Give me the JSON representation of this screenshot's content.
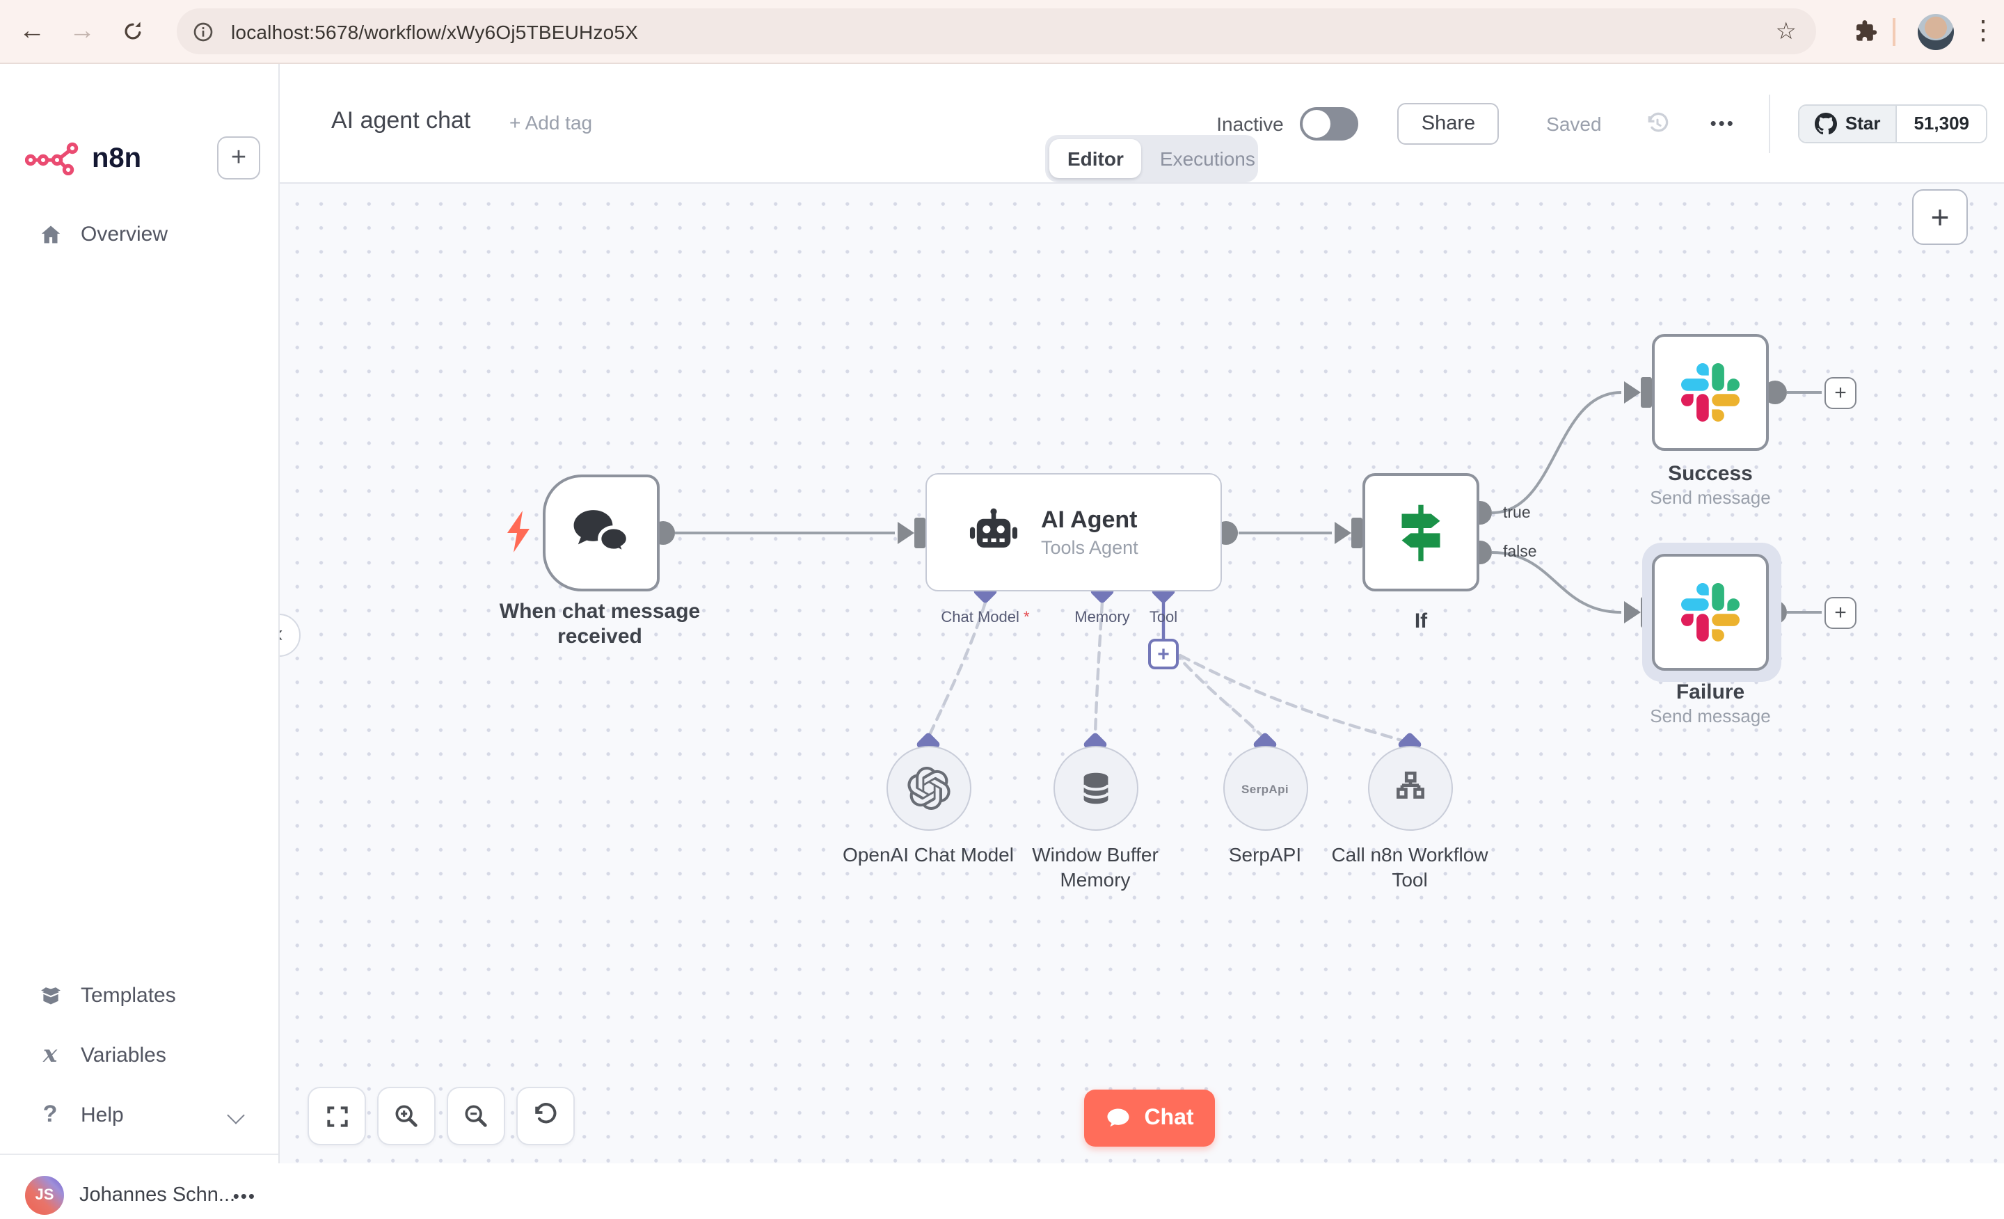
{
  "browser": {
    "url": "localhost:5678/workflow/xWy6Oj5TBEUHzo5X"
  },
  "sidebar": {
    "logo_text": "n8n",
    "items": [
      {
        "label": "Overview"
      },
      {
        "label": "Templates"
      },
      {
        "label": "Variables"
      },
      {
        "label": "Help"
      }
    ],
    "user": {
      "initials": "JS",
      "name": "Johannes Schn...",
      "menu_dots": "•••"
    }
  },
  "header": {
    "title": "AI agent chat",
    "add_tag_label": "+ Add tag",
    "activation_status": "Inactive",
    "share_label": "Share",
    "saved_label": "Saved",
    "menu_dots": "•••",
    "github": {
      "star_label": "Star",
      "star_count": "51,309"
    }
  },
  "tabs": {
    "editor": "Editor",
    "executions": "Executions"
  },
  "workflow": {
    "trigger": {
      "label": "When chat message received"
    },
    "agent": {
      "title": "AI Agent",
      "subtitle": "Tools Agent",
      "ports": [
        {
          "label": "Chat Model",
          "required_mark": "*"
        },
        {
          "label": "Memory"
        },
        {
          "label": "Tool"
        }
      ]
    },
    "if_node": {
      "label": "If",
      "output_true": "true",
      "output_false": "false"
    },
    "success": {
      "label": "Success",
      "subtitle": "Send message"
    },
    "failure": {
      "label": "Failure",
      "subtitle": "Send message"
    },
    "subnodes": [
      {
        "label": "OpenAI Chat Model"
      },
      {
        "label": "Window Buffer Memory"
      },
      {
        "label": "SerpAPI",
        "icon_text": "SerpApi"
      },
      {
        "label": "Call n8n Workflow Tool"
      }
    ]
  },
  "chat_button": {
    "label": "Chat"
  },
  "glyphs": {
    "plus": "+",
    "back_arrow": "←",
    "forward_arrow": "→",
    "bookmark_star": "☆",
    "kebab": "⋮",
    "collapse_chevron": "‹",
    "variables_x": "x",
    "help_question": "?"
  },
  "colors": {
    "brand_pink": "#EA4B71",
    "chat_accent": "#FF6D5A",
    "bolt": "#FF6A55",
    "if_green": "#1A9248",
    "connector_purple": "#7377B8",
    "slack_blue": "#36C5F0",
    "slack_green": "#2EB67D",
    "slack_yellow": "#ECB22E",
    "slack_red": "#E01E5A"
  }
}
